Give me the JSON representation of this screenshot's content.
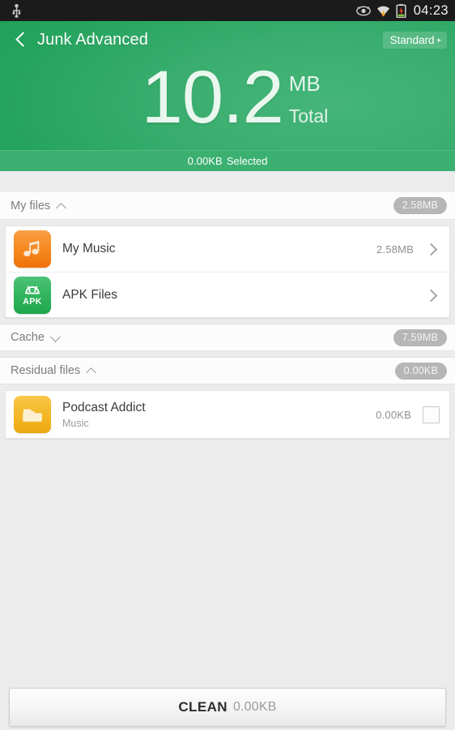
{
  "status_bar": {
    "usb_icon": "usb-icon",
    "eye_icon": "eye-icon",
    "wifi_icon": "wifi-icon",
    "battery_icon": "battery-charging-icon",
    "time": "04:23"
  },
  "header": {
    "back_icon": "back-chevron-icon",
    "title": "Junk Advanced",
    "mode_label": "Standard",
    "mode_arrow": "▸",
    "total_value": "10.2",
    "total_unit": "MB",
    "total_label": "Total",
    "selected_size": "0.00KB",
    "selected_label": "Selected"
  },
  "sections": [
    {
      "name": "my-files",
      "title": "My files",
      "expanded": true,
      "chevron": "chevron-up-icon",
      "badge": "2.58MB",
      "items": [
        {
          "name": "my-music",
          "icon": "music-note-icon",
          "title": "My Music",
          "subtitle": "",
          "size": "2.58MB",
          "has_chevron": true,
          "has_checkbox": false
        },
        {
          "name": "apk-files",
          "icon": "apk-android-icon",
          "title": "APK Files",
          "subtitle": "",
          "size": "",
          "has_chevron": true,
          "has_checkbox": false
        }
      ]
    },
    {
      "name": "cache",
      "title": "Cache",
      "expanded": false,
      "chevron": "chevron-down-icon",
      "badge": "7.59MB",
      "items": []
    },
    {
      "name": "residual-files",
      "title": "Residual files",
      "expanded": true,
      "chevron": "chevron-up-icon",
      "badge": "0.00KB",
      "items": [
        {
          "name": "podcast-addict",
          "icon": "folder-icon",
          "title": "Podcast Addict",
          "subtitle": "Music",
          "size": "0.00KB",
          "has_chevron": false,
          "has_checkbox": true
        }
      ]
    }
  ],
  "bottom": {
    "clean_label": "CLEAN",
    "clean_size": "0.00KB"
  },
  "colors": {
    "header_green": "#23a35c",
    "selected_bar_green": "#3bb071",
    "background": "#ececec",
    "badge_gray": "#b6b6b6",
    "music_orange": "#f68a22",
    "apk_green": "#32b45f",
    "folder_amber": "#f4b828"
  }
}
